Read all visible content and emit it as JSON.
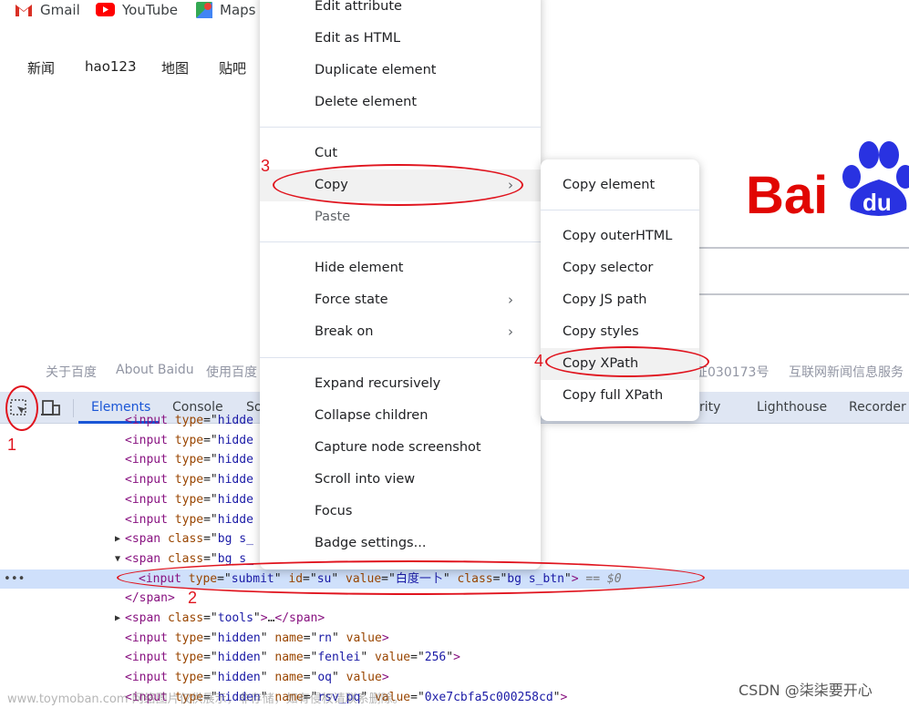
{
  "bookmarks": [
    {
      "label": "Gmail",
      "icon": "gmail-icon"
    },
    {
      "label": "YouTube",
      "icon": "youtube-icon"
    },
    {
      "label": "Maps",
      "icon": "maps-icon"
    }
  ],
  "nav": [
    "新闻",
    "hao123",
    "地图",
    "贴吧"
  ],
  "logo": {
    "text": "Baidu",
    "colors": {
      "red": "#e10602",
      "blue": "#2932e1"
    }
  },
  "footer": [
    "关于百度",
    "About Baidu",
    "使用百度",
    "证030173号",
    "互联网新闻信息服务"
  ],
  "devtools": {
    "tabs": [
      "Elements",
      "Console",
      "So",
      "rity",
      "Lighthouse",
      "Recorder"
    ],
    "active_tab": "Elements",
    "accent": "#1a56d6"
  },
  "code_lines": [
    {
      "indent": 0,
      "tri": "",
      "seg": [
        [
          "t",
          "<input "
        ],
        [
          "a",
          "type"
        ],
        [
          "p",
          "=\""
        ],
        [
          "v",
          "hidde"
        ]
      ]
    },
    {
      "indent": 0,
      "tri": "",
      "seg": [
        [
          "t",
          "<input "
        ],
        [
          "a",
          "type"
        ],
        [
          "p",
          "=\""
        ],
        [
          "v",
          "hidde"
        ]
      ]
    },
    {
      "indent": 0,
      "tri": "",
      "seg": [
        [
          "t",
          "<input "
        ],
        [
          "a",
          "type"
        ],
        [
          "p",
          "=\""
        ],
        [
          "v",
          "hidde"
        ]
      ]
    },
    {
      "indent": 0,
      "tri": "",
      "seg": [
        [
          "t",
          "<input "
        ],
        [
          "a",
          "type"
        ],
        [
          "p",
          "=\""
        ],
        [
          "v",
          "hidde"
        ]
      ]
    },
    {
      "indent": 0,
      "tri": "",
      "seg": [
        [
          "t",
          "<input "
        ],
        [
          "a",
          "type"
        ],
        [
          "p",
          "=\""
        ],
        [
          "v",
          "hidde"
        ]
      ]
    },
    {
      "indent": 0,
      "tri": "",
      "seg": [
        [
          "t",
          "<input "
        ],
        [
          "a",
          "type"
        ],
        [
          "p",
          "=\""
        ],
        [
          "v",
          "hidde"
        ]
      ]
    },
    {
      "indent": 0,
      "tri": "▶",
      "seg": [
        [
          "t",
          "<span "
        ],
        [
          "a",
          "class"
        ],
        [
          "p",
          "=\""
        ],
        [
          "v",
          "bg s_"
        ],
        [
          "p",
          "                    "
        ],
        [
          "t",
          "/span>"
        ]
      ]
    },
    {
      "indent": 0,
      "tri": "▼",
      "seg": [
        [
          "t",
          "<span "
        ],
        [
          "a",
          "class"
        ],
        [
          "p",
          "=\""
        ],
        [
          "v",
          "bg s_"
        ]
      ]
    },
    {
      "indent": 1,
      "tri": "",
      "sel": true,
      "seg": [
        [
          "t",
          "<input "
        ],
        [
          "a",
          "type"
        ],
        [
          "p",
          "=\""
        ],
        [
          "v",
          "submit"
        ],
        [
          "p",
          "\" "
        ],
        [
          "a",
          "id"
        ],
        [
          "p",
          "=\""
        ],
        [
          "v",
          "su"
        ],
        [
          "p",
          "\" "
        ],
        [
          "a",
          "value"
        ],
        [
          "p",
          "=\""
        ],
        [
          "v",
          "白度一卜"
        ],
        [
          "p",
          "\" "
        ],
        [
          "a",
          "class"
        ],
        [
          "p",
          "=\""
        ],
        [
          "v",
          "bg s_btn"
        ],
        [
          "p",
          "\""
        ],
        [
          "t",
          ">"
        ],
        [
          "c",
          " == $0"
        ]
      ]
    },
    {
      "indent": 0,
      "tri": "",
      "seg": [
        [
          "t",
          "</span>"
        ]
      ]
    },
    {
      "indent": 0,
      "tri": "▶",
      "seg": [
        [
          "t",
          "<span "
        ],
        [
          "a",
          "class"
        ],
        [
          "p",
          "=\""
        ],
        [
          "v",
          "tools"
        ],
        [
          "p",
          "\""
        ],
        [
          "t",
          ">"
        ],
        [
          "p",
          "…"
        ],
        [
          "t",
          "</span>"
        ]
      ]
    },
    {
      "indent": 0,
      "tri": "",
      "seg": [
        [
          "t",
          "<input "
        ],
        [
          "a",
          "type"
        ],
        [
          "p",
          "=\""
        ],
        [
          "v",
          "hidden"
        ],
        [
          "p",
          "\" "
        ],
        [
          "a",
          "name"
        ],
        [
          "p",
          "=\""
        ],
        [
          "v",
          "rn"
        ],
        [
          "p",
          "\" "
        ],
        [
          "a",
          "value"
        ],
        [
          "t",
          ">"
        ]
      ]
    },
    {
      "indent": 0,
      "tri": "",
      "seg": [
        [
          "t",
          "<input "
        ],
        [
          "a",
          "type"
        ],
        [
          "p",
          "=\""
        ],
        [
          "v",
          "hidden"
        ],
        [
          "p",
          "\" "
        ],
        [
          "a",
          "name"
        ],
        [
          "p",
          "=\""
        ],
        [
          "v",
          "fenlei"
        ],
        [
          "p",
          "\" "
        ],
        [
          "a",
          "value"
        ],
        [
          "p",
          "=\""
        ],
        [
          "v",
          "256"
        ],
        [
          "p",
          "\""
        ],
        [
          "t",
          ">"
        ]
      ]
    },
    {
      "indent": 0,
      "tri": "",
      "seg": [
        [
          "t",
          "<input "
        ],
        [
          "a",
          "type"
        ],
        [
          "p",
          "=\""
        ],
        [
          "v",
          "hidden"
        ],
        [
          "p",
          "\" "
        ],
        [
          "a",
          "name"
        ],
        [
          "p",
          "=\""
        ],
        [
          "v",
          "oq"
        ],
        [
          "p",
          "\" "
        ],
        [
          "a",
          "value"
        ],
        [
          "t",
          ">"
        ]
      ]
    },
    {
      "indent": 0,
      "tri": "",
      "seg": [
        [
          "t",
          "<input "
        ],
        [
          "a",
          "type"
        ],
        [
          "p",
          "=\""
        ],
        [
          "v",
          "hidden"
        ],
        [
          "p",
          "\" "
        ],
        [
          "a",
          "name"
        ],
        [
          "p",
          "=\""
        ],
        [
          "v",
          "rsv_pq"
        ],
        [
          "p",
          "\" "
        ],
        [
          "a",
          "value"
        ],
        [
          "p",
          "=\""
        ],
        [
          "v",
          "0xe7cbfa5c000258cd"
        ],
        [
          "p",
          "\""
        ],
        [
          "t",
          ">"
        ]
      ]
    }
  ],
  "context_menu": {
    "items": [
      "Edit attribute",
      "Edit as HTML",
      "Duplicate element",
      "Delete element",
      "Cut",
      "Copy",
      "Paste",
      "Hide element",
      "Force state",
      "Break on",
      "Expand recursively",
      "Collapse children",
      "Capture node screenshot",
      "Scroll into view",
      "Focus",
      "Badge settings..."
    ],
    "highlighted": "Copy",
    "disabled": [
      "Paste"
    ],
    "with_submenu": [
      "Copy",
      "Force state",
      "Break on"
    ]
  },
  "copy_submenu": {
    "items": [
      "Copy element",
      "Copy outerHTML",
      "Copy selector",
      "Copy JS path",
      "Copy styles",
      "Copy XPath",
      "Copy full XPath"
    ],
    "highlighted": "Copy XPath"
  },
  "annotations": {
    "color": "#e0141e",
    "labels": [
      "1",
      "2",
      "3",
      "4"
    ]
  },
  "watermark": "www.toymoban.com 网络图片仅供展示，非存储，如有侵权请联系删除。",
  "credit": "CSDN @柒柒要开心"
}
